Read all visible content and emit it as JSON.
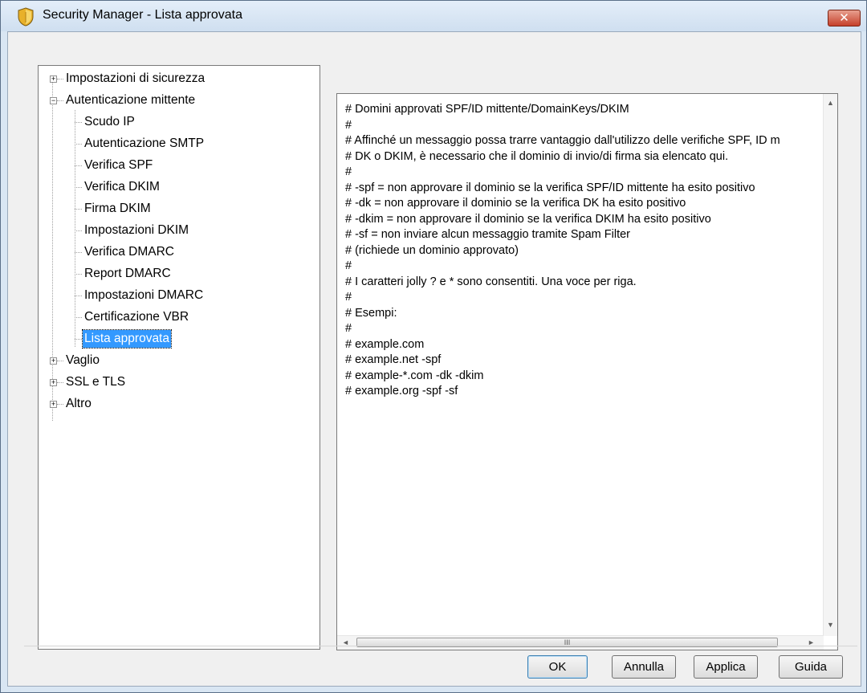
{
  "window": {
    "title": "Security Manager - Lista approvata",
    "close_glyph": "✕"
  },
  "tree": {
    "items": [
      {
        "label": "Impostazioni di sicurezza",
        "expander": "+"
      },
      {
        "label": "Autenticazione mittente",
        "expander": "−"
      },
      {
        "label": "Scudo IP"
      },
      {
        "label": "Autenticazione SMTP"
      },
      {
        "label": "Verifica SPF"
      },
      {
        "label": "Verifica DKIM"
      },
      {
        "label": "Firma DKIM"
      },
      {
        "label": "Impostazioni DKIM"
      },
      {
        "label": "Verifica DMARC"
      },
      {
        "label": "Report DMARC"
      },
      {
        "label": "Impostazioni DMARC"
      },
      {
        "label": "Certificazione VBR"
      },
      {
        "label": "Lista approvata",
        "selected": true
      },
      {
        "label": "Vaglio",
        "expander": "+"
      },
      {
        "label": "SSL e TLS",
        "expander": "+"
      },
      {
        "label": "Altro",
        "expander": "+"
      }
    ]
  },
  "editor": {
    "text": "# Domini approvati SPF/ID mittente/DomainKeys/DKIM\n#\n# Affinché un messaggio possa trarre vantaggio dall'utilizzo delle verifiche SPF, ID m\n# DK o DKIM, è necessario che il dominio di invio/di firma sia elencato qui.\n#\n# -spf = non approvare il dominio se la verifica SPF/ID mittente ha esito positivo\n# -dk = non approvare il dominio se la verifica DK ha esito positivo\n# -dkim = non approvare il dominio se la verifica DKIM ha esito positivo\n# -sf = non inviare alcun messaggio tramite Spam Filter\n# (richiede un dominio approvato)\n#\n# I caratteri jolly ? e * sono consentiti. Una voce per riga.\n#\n# Esempi:\n#\n# example.com\n# example.net -spf\n# example-*.com -dk -dkim\n# example.org -spf -sf",
    "scroll_up": "▲",
    "scroll_down": "▼",
    "scroll_left": "◄",
    "scroll_right": "►",
    "thumb_grip": "III"
  },
  "buttons": {
    "ok": "OK",
    "cancel": "Annulla",
    "apply": "Applica",
    "help": "Guida"
  }
}
